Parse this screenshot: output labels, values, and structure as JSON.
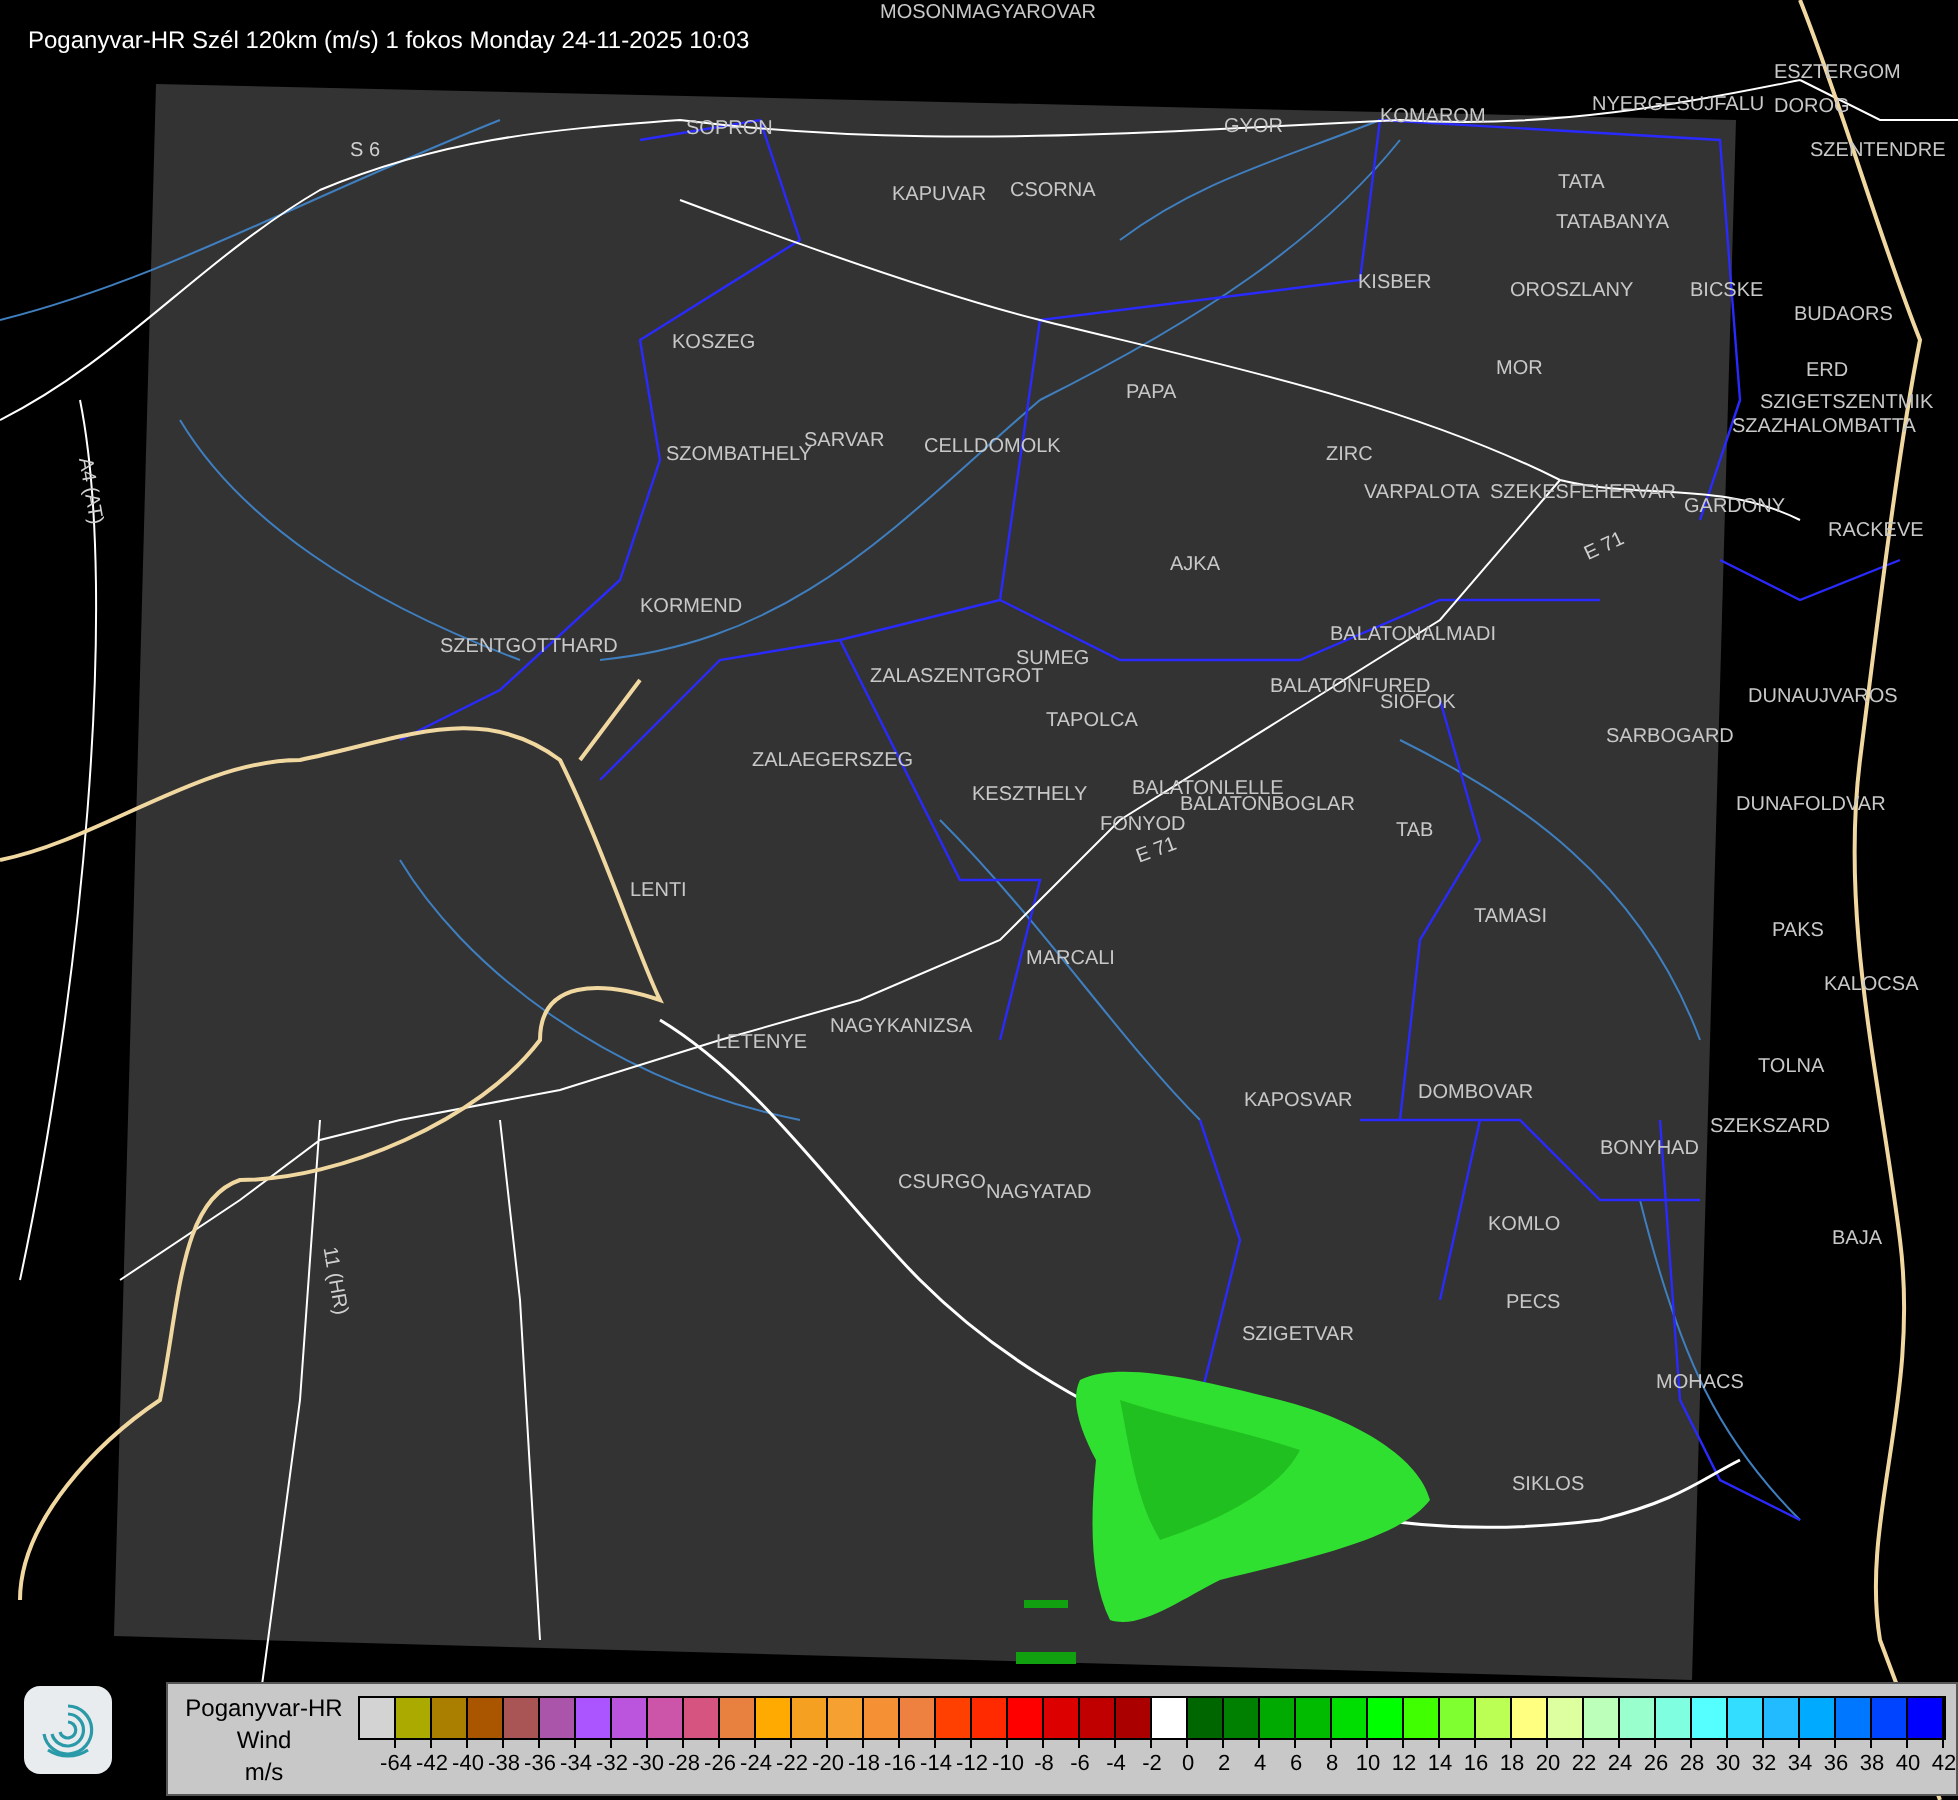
{
  "title": "Poganyvar-HR Szél 120km (m/s) 1 fokos Monday 24-11-2025 10:03",
  "map_labels": [
    {
      "text": "MOSONMAGYAROVAR"
    },
    {
      "text": "SOPRON"
    },
    {
      "text": "GYOR"
    },
    {
      "text": "KOMAROM"
    },
    {
      "text": "ESZTERGOM"
    },
    {
      "text": "NYERGESUJFALU"
    },
    {
      "text": "DOROG"
    },
    {
      "text": "SZENTENDRE"
    },
    {
      "text": "KAPUVAR"
    },
    {
      "text": "CSORNA"
    },
    {
      "text": "TATA"
    },
    {
      "text": "TATABANYA"
    },
    {
      "text": "KISBER"
    },
    {
      "text": "OROSZLANY"
    },
    {
      "text": "BICSKE"
    },
    {
      "text": "BUDAORS"
    },
    {
      "text": "KOSZEG"
    },
    {
      "text": "MOR"
    },
    {
      "text": "PAPA"
    },
    {
      "text": "ERD"
    },
    {
      "text": "SZIGETSZENTMIK"
    },
    {
      "text": "SZAZHALOMBATTA"
    },
    {
      "text": "SARVAR"
    },
    {
      "text": "SZOMBATHELY"
    },
    {
      "text": "CELLDOMOLK"
    },
    {
      "text": "ZIRC"
    },
    {
      "text": "VARPALOTA"
    },
    {
      "text": "SZEKESFEHERVAR"
    },
    {
      "text": "GARDONY"
    },
    {
      "text": "RACKEVE"
    },
    {
      "text": "AJKA"
    },
    {
      "text": "KORMEND"
    },
    {
      "text": "SZENTGOTTHARD"
    },
    {
      "text": "BALATONALMADI"
    },
    {
      "text": "SUMEG"
    },
    {
      "text": "ZALASZENTGROT"
    },
    {
      "text": "BALATONFURED"
    },
    {
      "text": "SIOFOK"
    },
    {
      "text": "TAPOLCA"
    },
    {
      "text": "DUNAUJVAROS"
    },
    {
      "text": "ZALAEGERSZEG"
    },
    {
      "text": "SARBOGARD"
    },
    {
      "text": "BALATONLELLE"
    },
    {
      "text": "BALATONBOGLAR"
    },
    {
      "text": "FONYOD"
    },
    {
      "text": "KESZTHELY"
    },
    {
      "text": "DUNAFOLDVAR"
    },
    {
      "text": "TAB"
    },
    {
      "text": "LENTI"
    },
    {
      "text": "TAMASI"
    },
    {
      "text": "PAKS"
    },
    {
      "text": "MARCALI"
    },
    {
      "text": "KALOCSA"
    },
    {
      "text": "NAGYKANIZSA"
    },
    {
      "text": "LETENYE"
    },
    {
      "text": "TOLNA"
    },
    {
      "text": "KAPOSVAR"
    },
    {
      "text": "DOMBOVAR"
    },
    {
      "text": "SZEKSZARD"
    },
    {
      "text": "BONYHAD"
    },
    {
      "text": "CSURGO"
    },
    {
      "text": "NAGYATAD"
    },
    {
      "text": "KOMLO"
    },
    {
      "text": "BAJA"
    },
    {
      "text": "PECS"
    },
    {
      "text": "SZIGETVAR"
    },
    {
      "text": "MOHACS"
    },
    {
      "text": "SIKLOS"
    }
  ],
  "road_labels": [
    {
      "text": "S 6"
    },
    {
      "text": "A4 (AT)"
    },
    {
      "text": "11 (HR)"
    },
    {
      "text": "E 71"
    },
    {
      "text": "E 71"
    }
  ],
  "legend": {
    "lines": [
      "Poganyvar-HR",
      "Wind",
      "m/s"
    ],
    "swatches": [
      {
        "color": "#d3d3d3"
      },
      {
        "color": "#aaaa00"
      },
      {
        "color": "#aa7f00"
      },
      {
        "color": "#aa5500"
      },
      {
        "color": "#aa5555"
      },
      {
        "color": "#aa55aa"
      },
      {
        "color": "#aa55ff"
      },
      {
        "color": "#bb55dd"
      },
      {
        "color": "#cc55aa"
      },
      {
        "color": "#d55580"
      },
      {
        "color": "#e88040"
      },
      {
        "color": "#ffaa00"
      },
      {
        "color": "#f5a020"
      },
      {
        "color": "#f5a030"
      },
      {
        "color": "#f59035"
      },
      {
        "color": "#ee8040"
      },
      {
        "color": "#ff4000"
      },
      {
        "color": "#ff2a00"
      },
      {
        "color": "#ff0000"
      },
      {
        "color": "#dd0000"
      },
      {
        "color": "#c00000"
      },
      {
        "color": "#aa0000"
      },
      {
        "color": "#ffffff"
      },
      {
        "color": "#006600"
      },
      {
        "color": "#008000"
      },
      {
        "color": "#00aa00"
      },
      {
        "color": "#00bb00"
      },
      {
        "color": "#00dd00"
      },
      {
        "color": "#00ff00"
      },
      {
        "color": "#40ff00"
      },
      {
        "color": "#80ff30"
      },
      {
        "color": "#bbff55"
      },
      {
        "color": "#ffff80"
      },
      {
        "color": "#ddffa0"
      },
      {
        "color": "#bbffbb"
      },
      {
        "color": "#99ffcc"
      },
      {
        "color": "#80ffe0"
      },
      {
        "color": "#55ffff"
      },
      {
        "color": "#33ddff"
      },
      {
        "color": "#22bbff"
      },
      {
        "color": "#00aaff"
      },
      {
        "color": "#0077ff"
      },
      {
        "color": "#0044ff"
      },
      {
        "color": "#0000ff"
      }
    ],
    "ticks": [
      "-64",
      "-42",
      "-40",
      "-38",
      "-36",
      "-34",
      "-32",
      "-30",
      "-28",
      "-26",
      "-24",
      "-22",
      "-20",
      "-18",
      "-16",
      "-14",
      "-12",
      "-10",
      "-8",
      "-6",
      "-4",
      "-2",
      "0",
      "2",
      "4",
      "6",
      "8",
      "10",
      "12",
      "14",
      "16",
      "18",
      "20",
      "22",
      "24",
      "26",
      "28",
      "30",
      "32",
      "34",
      "36",
      "38",
      "40",
      "42"
    ]
  }
}
